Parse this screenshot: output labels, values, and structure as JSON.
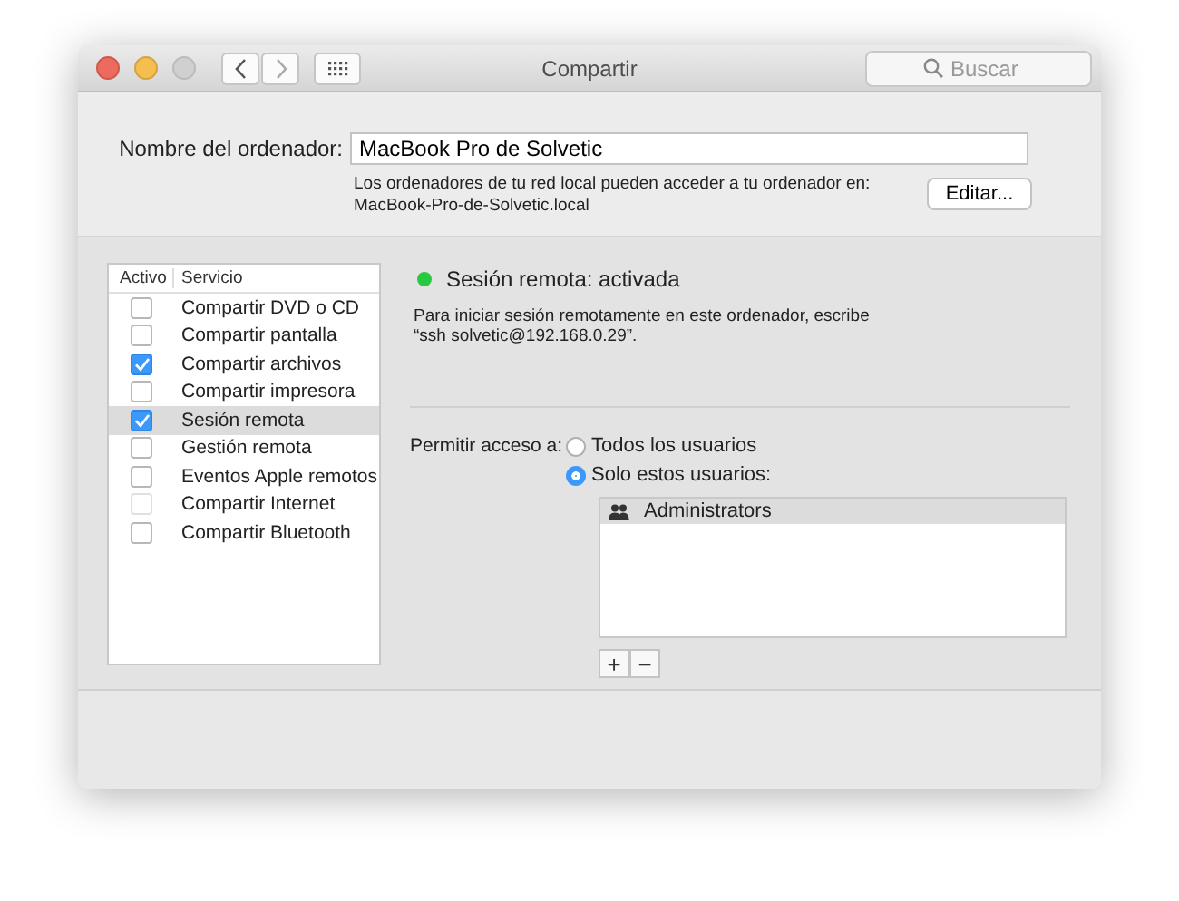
{
  "window": {
    "title": "Compartir",
    "search": {
      "placeholder": "Buscar"
    }
  },
  "computer_name": {
    "label": "Nombre del ordenador:",
    "value": "MacBook Pro de Solvetic",
    "info": "Los ordenadores de tu red local pueden acceder a tu ordenador en:",
    "address": "MacBook-Pro-de-Solvetic.local",
    "button": "Editar..."
  },
  "services": {
    "columns": [
      "Activo",
      "Servicio"
    ],
    "rows": [
      {
        "name": "Compartir DVD o CD",
        "checked": false,
        "selected": false,
        "disabled": false
      },
      {
        "name": "Compartir pantalla",
        "checked": false,
        "selected": false,
        "disabled": false
      },
      {
        "name": "Compartir archivos",
        "checked": true,
        "selected": false,
        "disabled": false
      },
      {
        "name": "Compartir impresora",
        "checked": false,
        "selected": false,
        "disabled": false
      },
      {
        "name": "Sesión remota",
        "checked": true,
        "selected": true,
        "disabled": false
      },
      {
        "name": "Gestión remota",
        "checked": false,
        "selected": false,
        "disabled": false
      },
      {
        "name": "Eventos Apple remotos",
        "checked": false,
        "selected": false,
        "disabled": false
      },
      {
        "name": "Compartir Internet",
        "checked": false,
        "selected": false,
        "disabled": true
      },
      {
        "name": "Compartir Bluetooth",
        "checked": false,
        "selected": false,
        "disabled": false
      }
    ]
  },
  "detail": {
    "status": "Sesión remota: activada",
    "status_on": true,
    "instructions": "Para iniciar sesión remotamente en este ordenador, escribe\n“ssh solvetic@192.168.0.29”.",
    "access_label": "Permitir acceso a:",
    "access_options": [
      {
        "label": "Todos los usuarios",
        "selected": false
      },
      {
        "label": "Solo estos usuarios:",
        "selected": true
      }
    ],
    "users": [
      {
        "name": "Administrators",
        "selected": true
      }
    ],
    "buttons": [
      "+",
      "−"
    ]
  }
}
